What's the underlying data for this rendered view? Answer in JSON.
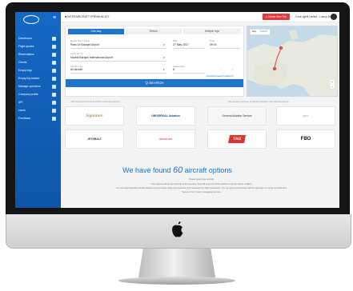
{
  "sidebar": {
    "items": [
      {
        "label": "Dashboard"
      },
      {
        "label": "Flight quotes"
      },
      {
        "label": "Reservations"
      },
      {
        "label": "Clients"
      },
      {
        "label": "Empty legs"
      },
      {
        "label": "Empty leg tracker"
      },
      {
        "label": "Manage operators"
      },
      {
        "label": "Company profile"
      },
      {
        "label": "API"
      },
      {
        "label": "Users"
      },
      {
        "label": "Feedback"
      }
    ]
  },
  "topbar": {
    "breadcrumb": "■ INTERAIRCRAFT PREMIUM JET",
    "quote_button": "▸ Create New Trip",
    "user_name": "Cova Ujjetil Limited - Luxury Jets"
  },
  "booking": {
    "tabs": [
      {
        "label": "One way"
      },
      {
        "label": "Return"
      },
      {
        "label": "Multiple legs"
      }
    ],
    "from_label": "Depart from / Point",
    "from_value": "Paris Le Bourget Airport",
    "to_label": "Arrive at / To",
    "to_value": "Madrid Barajas International Airport",
    "date_label": "Date",
    "date_value": "27 May 2017",
    "time_label": "Time",
    "time_value": "09:00",
    "aircraft_label": "Aircraft type",
    "aircraft_value": "All aircraft",
    "passengers_label": "Passengers",
    "passengers_value": "8",
    "advanced_link": "Advanced search options ▾",
    "search_button": "Q SEARCH"
  },
  "map": {
    "tab_map": "Map",
    "tab_satellite": "Satellite"
  },
  "operators": {
    "head_left": "We support services at Paris Le Bourget Airport",
    "head_right": "We support services at Madrid Barajas International Airport",
    "cards": [
      {
        "label": "Signature"
      },
      {
        "label": "UNIVERSAL Aviation"
      },
      {
        "label": "General Aviation Service"
      },
      {
        "label": "jetex"
      },
      {
        "label": "JETHRALT"
      },
      {
        "label": "Advanced"
      },
      {
        "label": "TAG"
      },
      {
        "label": "FBO"
      }
    ]
  },
  "results": {
    "headline_before": "We have found ",
    "headline_number": "60",
    "headline_after": " aircraft options",
    "sub": "Please select your aircraft",
    "paragraph_1": "Your request will be sent directly to the operator, they will respond via the platform and you will be notified.",
    "paragraph_2": "You can view Operator contact details once you have made your selection and requested the flight quotations. You can also communicate with the operators by using our dedicated",
    "paragraph_3": "\"Secure Chat\" instant messaging service."
  },
  "colors": {
    "sidebar": "#1468c5",
    "accent": "#1e74c9",
    "quote_button": "#e03a3a"
  }
}
